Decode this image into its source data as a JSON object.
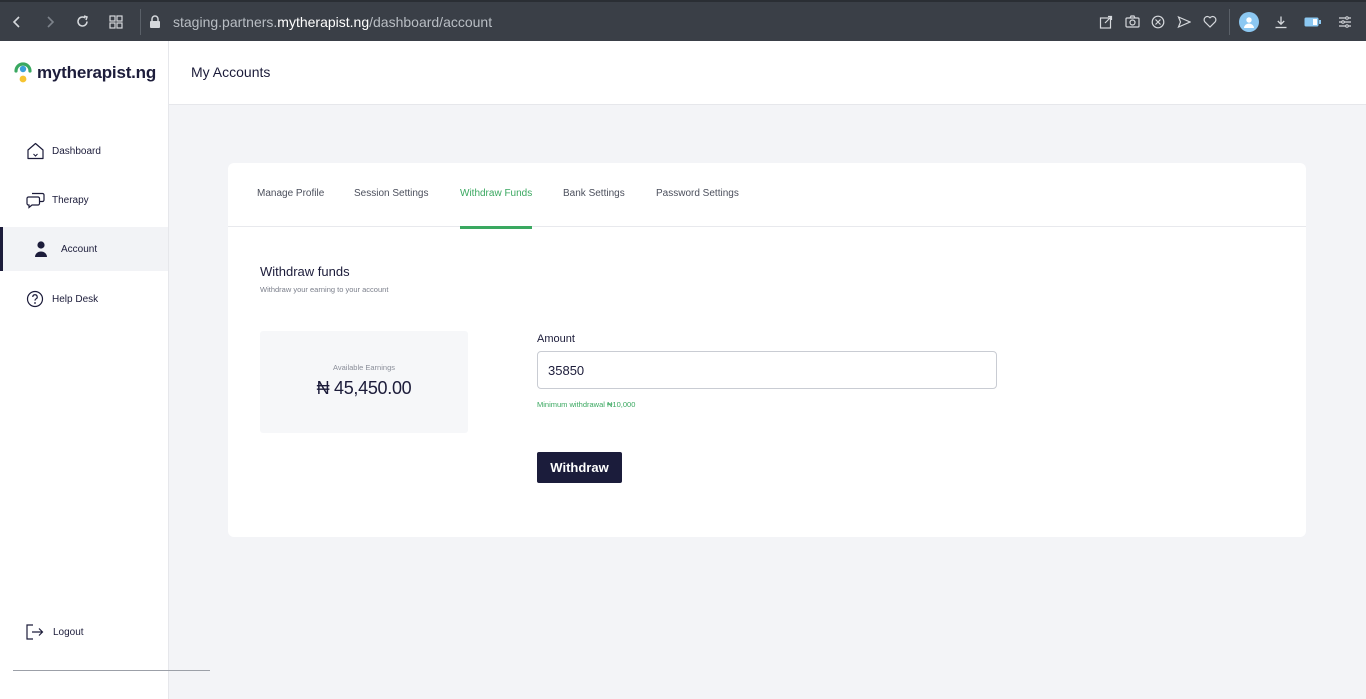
{
  "browser": {
    "url_prefix": "staging.partners.",
    "url_domain": "mytherapist.ng",
    "url_path": "/dashboard/account",
    "icons": [
      "back-icon",
      "forward-icon",
      "reload-icon",
      "tabs-grid-icon",
      "lock-icon",
      "share-icon",
      "camera-icon",
      "adblock-icon",
      "send-icon",
      "heart-icon",
      "profile-icon",
      "download-icon",
      "battery-icon",
      "menu-icon"
    ]
  },
  "logo": {
    "text": "mytherapist.ng"
  },
  "sidebar": {
    "items": [
      {
        "label": "Dashboard",
        "icon": "home-icon",
        "active": false
      },
      {
        "label": "Therapy",
        "icon": "chat-icon",
        "active": false
      },
      {
        "label": "Account",
        "icon": "user-icon",
        "active": true
      },
      {
        "label": "Help Desk",
        "icon": "help-icon",
        "active": false
      }
    ],
    "logout_label": "Logout"
  },
  "header": {
    "title": "My Accounts"
  },
  "tabs": [
    {
      "label": "Manage Profile",
      "active": false
    },
    {
      "label": "Session Settings",
      "active": false
    },
    {
      "label": "Withdraw Funds",
      "active": true
    },
    {
      "label": "Bank Settings",
      "active": false
    },
    {
      "label": "Password Settings",
      "active": false
    }
  ],
  "withdraw": {
    "title": "Withdraw funds",
    "subtitle": "Withdraw your earning to your account",
    "earnings_label": "Available Earnings",
    "earnings_value": "₦ 45,450.00",
    "amount_label": "Amount",
    "amount_value": "35850",
    "min_note": "Minimum withdrawal ₦10,000",
    "button_label": "Withdraw"
  },
  "colors": {
    "accent_green": "#3aa860",
    "navy": "#1b1c3b",
    "background": "#f3f4f7"
  }
}
